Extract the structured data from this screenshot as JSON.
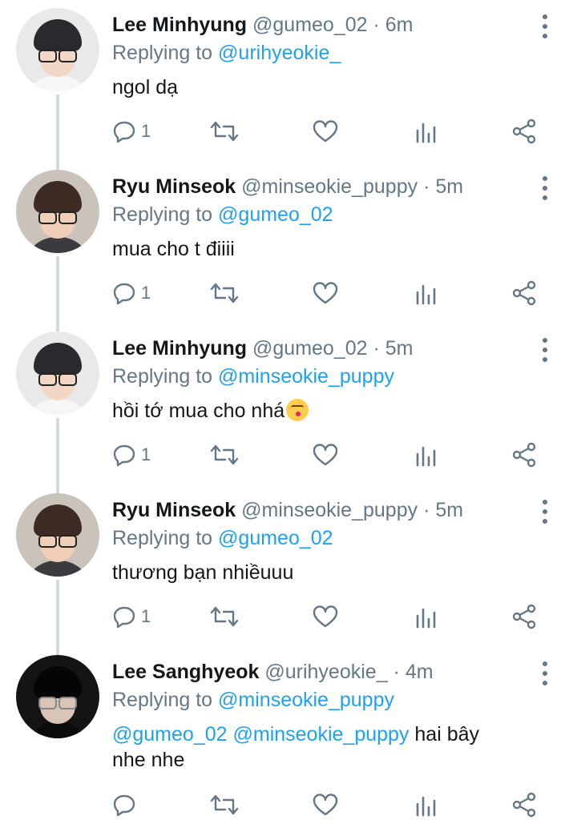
{
  "colors": {
    "accent": "#1da1f2",
    "muted": "#657786",
    "text": "#14171a",
    "thread": "#cfd9de"
  },
  "tweets": [
    {
      "name": "Lee Minhyung",
      "handle": "@gumeo_02",
      "time": "6m",
      "replying_prefix": "Replying to",
      "replying_to": "@urihyeokie_",
      "text": "ngol dạ",
      "reply_count": "1",
      "avatar": "avatar-lee-minhyung"
    },
    {
      "name": "Ryu Minseok",
      "handle": "@minseokie_puppy",
      "time": "5m",
      "replying_prefix": "Replying to",
      "replying_to": "@gumeo_02",
      "text": "mua cho t điiii",
      "reply_count": "1",
      "avatar": "avatar-ryu-minseok"
    },
    {
      "name": "Lee Minhyung",
      "handle": "@gumeo_02",
      "time": "5m",
      "replying_prefix": "Replying to",
      "replying_to": "@minseokie_puppy",
      "text": "hồi tớ mua cho nhá",
      "emoji": "kissing-face-emoji",
      "reply_count": "1",
      "avatar": "avatar-lee-minhyung"
    },
    {
      "name": "Ryu Minseok",
      "handle": "@minseokie_puppy",
      "time": "5m",
      "replying_prefix": "Replying to",
      "replying_to": "@gumeo_02",
      "text": "thương bạn nhiềuuu",
      "reply_count": "1",
      "avatar": "avatar-ryu-minseok"
    },
    {
      "name": "Lee Sanghyeok",
      "handle": "@urihyeokie_",
      "time": "4m",
      "replying_prefix": "Replying to",
      "replying_to": "@minseokie_puppy",
      "text_mentions": [
        "@gumeo_02",
        "@minseokie_puppy"
      ],
      "text_line1": "hai bây",
      "text_line2": "nhe nhe",
      "reply_count": "",
      "avatar": "avatar-lee-sanghyeok"
    }
  ],
  "icons": [
    "reply-icon",
    "retweet-icon",
    "like-icon",
    "analytics-icon",
    "share-icon",
    "more-options-icon"
  ]
}
